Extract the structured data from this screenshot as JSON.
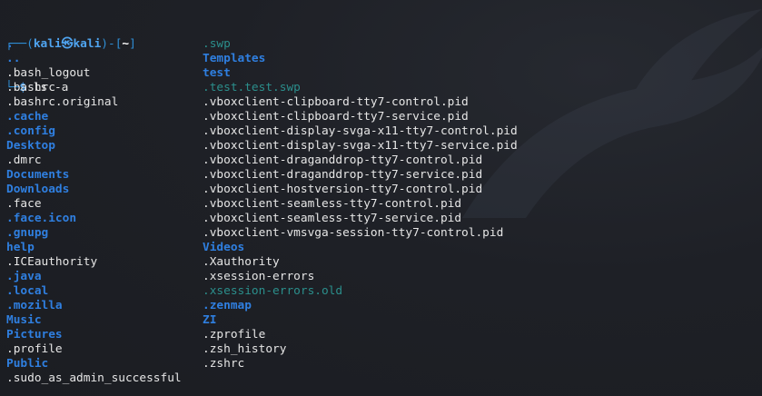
{
  "prompt": {
    "corner_top": "┌──(",
    "user": "kali",
    "at_symbol": "㉿",
    "host": "kali",
    "mid": ")-[",
    "cwd": "~",
    "end": "]",
    "corner_bottom": "└─",
    "dollar": "$",
    "command": " ls -a"
  },
  "colors": {
    "directory": "#2f7fe0",
    "file": "#e6e6e6",
    "swap_file": "#2b8f8c",
    "background": "#1d1f24"
  },
  "listing": {
    "column1": [
      {
        "name": ".",
        "type": "dir"
      },
      {
        "name": "..",
        "type": "dir"
      },
      {
        "name": ".bash_logout",
        "type": "file"
      },
      {
        "name": ".bashrc",
        "type": "file"
      },
      {
        "name": ".bashrc.original",
        "type": "file"
      },
      {
        "name": ".cache",
        "type": "dir"
      },
      {
        "name": ".config",
        "type": "dir"
      },
      {
        "name": "Desktop",
        "type": "dir"
      },
      {
        "name": ".dmrc",
        "type": "file"
      },
      {
        "name": "Documents",
        "type": "dir"
      },
      {
        "name": "Downloads",
        "type": "dir"
      },
      {
        "name": ".face",
        "type": "file"
      },
      {
        "name": ".face.icon",
        "type": "dir"
      },
      {
        "name": ".gnupg",
        "type": "dir"
      },
      {
        "name": "help",
        "type": "dir"
      },
      {
        "name": ".ICEauthority",
        "type": "file"
      },
      {
        "name": ".java",
        "type": "dir"
      },
      {
        "name": ".local",
        "type": "dir"
      },
      {
        "name": ".mozilla",
        "type": "dir"
      },
      {
        "name": "Music",
        "type": "dir"
      },
      {
        "name": "Pictures",
        "type": "dir"
      },
      {
        "name": ".profile",
        "type": "file"
      },
      {
        "name": "Public",
        "type": "dir"
      },
      {
        "name": ".sudo_as_admin_successful",
        "type": "file"
      }
    ],
    "column2": [
      {
        "name": ".swp",
        "type": "swap"
      },
      {
        "name": "Templates",
        "type": "dir"
      },
      {
        "name": "test",
        "type": "dir"
      },
      {
        "name": ".test.test.swp",
        "type": "swap"
      },
      {
        "name": ".vboxclient-clipboard-tty7-control.pid",
        "type": "file"
      },
      {
        "name": ".vboxclient-clipboard-tty7-service.pid",
        "type": "file"
      },
      {
        "name": ".vboxclient-display-svga-x11-tty7-control.pid",
        "type": "file"
      },
      {
        "name": ".vboxclient-display-svga-x11-tty7-service.pid",
        "type": "file"
      },
      {
        "name": ".vboxclient-draganddrop-tty7-control.pid",
        "type": "file"
      },
      {
        "name": ".vboxclient-draganddrop-tty7-service.pid",
        "type": "file"
      },
      {
        "name": ".vboxclient-hostversion-tty7-control.pid",
        "type": "file"
      },
      {
        "name": ".vboxclient-seamless-tty7-control.pid",
        "type": "file"
      },
      {
        "name": ".vboxclient-seamless-tty7-service.pid",
        "type": "file"
      },
      {
        "name": ".vboxclient-vmsvga-session-tty7-control.pid",
        "type": "file"
      },
      {
        "name": "Videos",
        "type": "dir"
      },
      {
        "name": ".Xauthority",
        "type": "file"
      },
      {
        "name": ".xsession-errors",
        "type": "file"
      },
      {
        "name": ".xsession-errors.old",
        "type": "swap"
      },
      {
        "name": ".zenmap",
        "type": "dir"
      },
      {
        "name": "ZI",
        "type": "dir"
      },
      {
        "name": ".zprofile",
        "type": "file"
      },
      {
        "name": ".zsh_history",
        "type": "file"
      },
      {
        "name": ".zshrc",
        "type": "file"
      }
    ]
  },
  "icons": {
    "background_logo": "kali-dragon-watermark-icon"
  }
}
